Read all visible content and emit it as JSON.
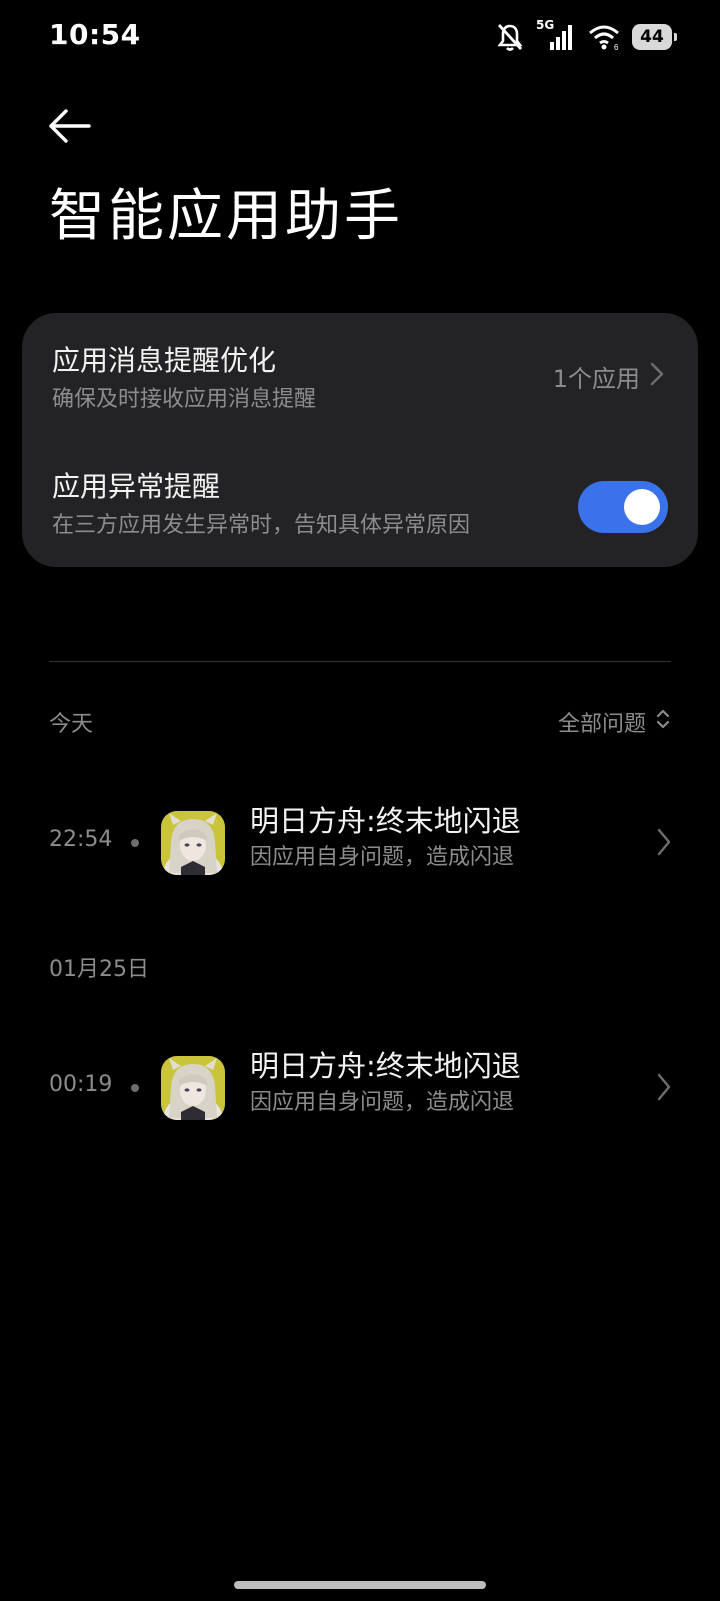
{
  "status_bar": {
    "time": "10:54",
    "network": "5G",
    "battery": "44",
    "icons": [
      "bell-off-icon",
      "cellular-signal-icon",
      "wifi-icon",
      "battery-icon"
    ]
  },
  "header": {
    "back_icon": "back-arrow-icon",
    "title": "智能应用助手"
  },
  "settings": {
    "message_optimization": {
      "title": "应用消息提醒优化",
      "subtitle": "确保及时接收应用消息提醒",
      "value": "1个应用"
    },
    "exception_alert": {
      "title": "应用异常提醒",
      "subtitle": "在三方应用发生异常时，告知具体异常原因",
      "enabled": true
    }
  },
  "history": {
    "filter_label": "全部问题",
    "groups": [
      {
        "date_label": "今天",
        "events": [
          {
            "time": "22:54",
            "app_title": "明日方舟:终末地闪退",
            "reason": "因应用自身问题，造成闪退"
          }
        ]
      },
      {
        "date_label": "01月25日",
        "events": [
          {
            "time": "00:19",
            "app_title": "明日方舟:终末地闪退",
            "reason": "因应用自身问题，造成闪退"
          }
        ]
      }
    ]
  },
  "colors": {
    "background": "#000000",
    "card": "#232325",
    "accent": "#3a72ec",
    "secondary_text": "#8c8c8e"
  }
}
